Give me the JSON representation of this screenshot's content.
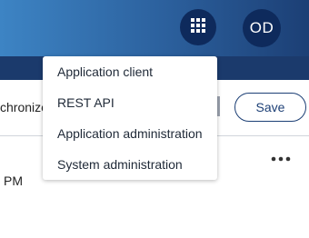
{
  "header": {
    "apps_icon": "grid-icon",
    "avatar_initials": "OD",
    "brand_color": "#0e2a5c"
  },
  "toolbar": {
    "sync_text_fragment": "chronize",
    "save_label": "Save"
  },
  "content": {
    "time_fragment": "PM",
    "more_icon": "ellipsis-horizontal-icon"
  },
  "apps_menu": {
    "items": [
      {
        "label": "Application client"
      },
      {
        "label": "REST API"
      },
      {
        "label": "Application administration"
      },
      {
        "label": "System administration"
      }
    ]
  }
}
